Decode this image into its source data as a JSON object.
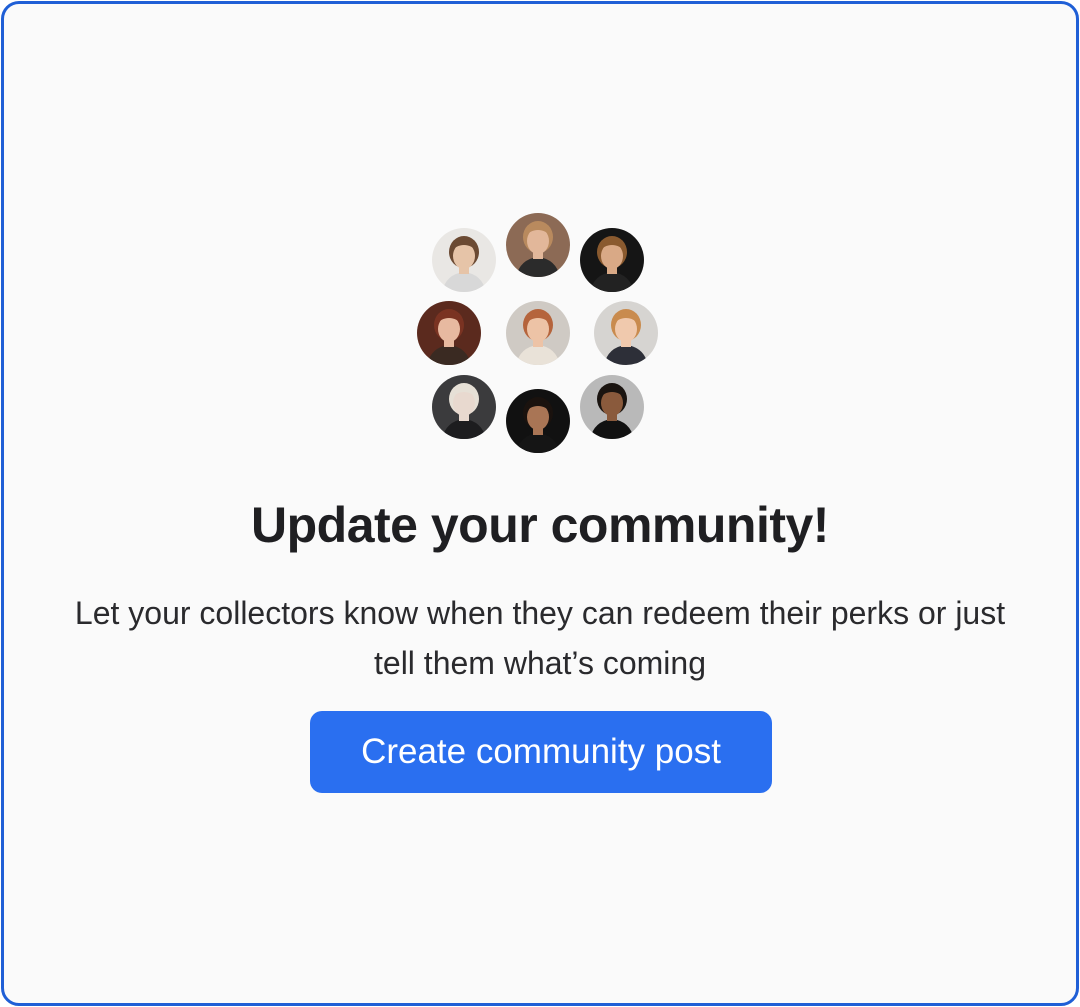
{
  "empty_state": {
    "title": "Update your community!",
    "description": "Let your collectors know when they can redeem their perks or just tell them what’s coming",
    "cta_label": "Create community post"
  },
  "avatars": [
    {
      "name": "avatar-1",
      "bg": "#e9e7e4",
      "skin": "#e6c4a8",
      "hair": "#6b4a33",
      "shirt": "#d8d8d8"
    },
    {
      "name": "avatar-2",
      "bg": "#8c6a55",
      "skin": "#e2b79a",
      "hair": "#b98a5e",
      "shirt": "#2b2b2b"
    },
    {
      "name": "avatar-3",
      "bg": "#151515",
      "skin": "#d9a986",
      "hair": "#8a5a2f",
      "shirt": "#222222"
    },
    {
      "name": "avatar-4",
      "bg": "#5b2a1e",
      "skin": "#e7b9a0",
      "hair": "#7a3322",
      "shirt": "#3a2a22"
    },
    {
      "name": "avatar-5",
      "bg": "#cfcac4",
      "skin": "#edc3a6",
      "hair": "#b5643c",
      "shirt": "#e9e2d8"
    },
    {
      "name": "avatar-6",
      "bg": "#d6d4d1",
      "skin": "#f0c9ad",
      "hair": "#c98b4e",
      "shirt": "#2d2f38"
    },
    {
      "name": "avatar-7",
      "bg": "#3b3b3d",
      "skin": "#e8d9cf",
      "hair": "#e6e0d6",
      "shirt": "#1d1d1f"
    },
    {
      "name": "avatar-8",
      "bg": "#111111",
      "skin": "#a97555",
      "hair": "#1a120e",
      "shirt": "#151515"
    },
    {
      "name": "avatar-9",
      "bg": "#b9b9b9",
      "skin": "#8a5a3c",
      "hair": "#1a1410",
      "shirt": "#111111"
    }
  ],
  "colors": {
    "accent": "#2a6ff0",
    "frame_border": "#1f5fd6",
    "background": "#fafafa"
  }
}
